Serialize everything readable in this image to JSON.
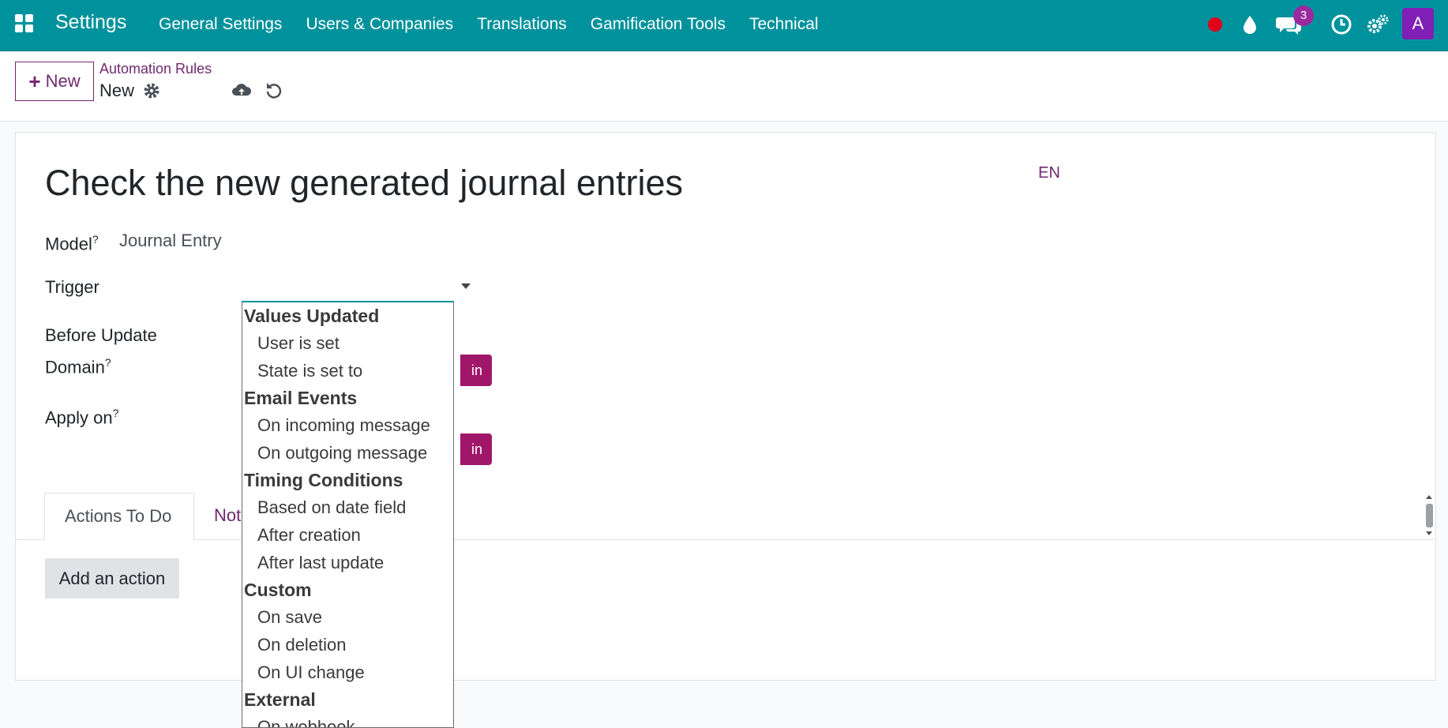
{
  "navbar": {
    "brand": "Settings",
    "menu": [
      {
        "label": "General Settings"
      },
      {
        "label": "Users & Companies"
      },
      {
        "label": "Translations"
      },
      {
        "label": "Gamification Tools"
      },
      {
        "label": "Technical"
      }
    ],
    "messages_count": "3",
    "avatar_letter": "A",
    "colors": {
      "navbar": "#00929c",
      "accent": "#71286f",
      "badge": "#9b2aa0",
      "recording": "#e3001b"
    }
  },
  "control_panel": {
    "new_button_label": "New",
    "breadcrumb_parent": "Automation Rules",
    "breadcrumb_current": "New"
  },
  "form": {
    "title": "Check the new generated journal entries",
    "language": "EN",
    "model": {
      "label": "Model",
      "help": "?",
      "value": "Journal Entry"
    },
    "trigger": {
      "label": "Trigger"
    },
    "before_update_domain": {
      "label_line1": "Before Update",
      "label_line2": "Domain",
      "help": "?"
    },
    "apply_on": {
      "label": "Apply on",
      "help": "?"
    },
    "edit_domain_button_label": "in",
    "tabs": [
      {
        "label": "Actions To Do"
      },
      {
        "label": "Not"
      }
    ],
    "add_action_label": "Add an action"
  },
  "trigger_dropdown": {
    "groups": [
      {
        "label": "Values Updated",
        "options": [
          "User is set",
          "State is set to"
        ]
      },
      {
        "label": "Email Events",
        "options": [
          "On incoming message",
          "On outgoing message"
        ]
      },
      {
        "label": "Timing Conditions",
        "options": [
          "Based on date field",
          "After creation",
          "After last update"
        ]
      },
      {
        "label": "Custom",
        "options": [
          "On save",
          "On deletion",
          "On UI change"
        ]
      },
      {
        "label": "External",
        "options": [
          "On webhook"
        ]
      }
    ]
  }
}
